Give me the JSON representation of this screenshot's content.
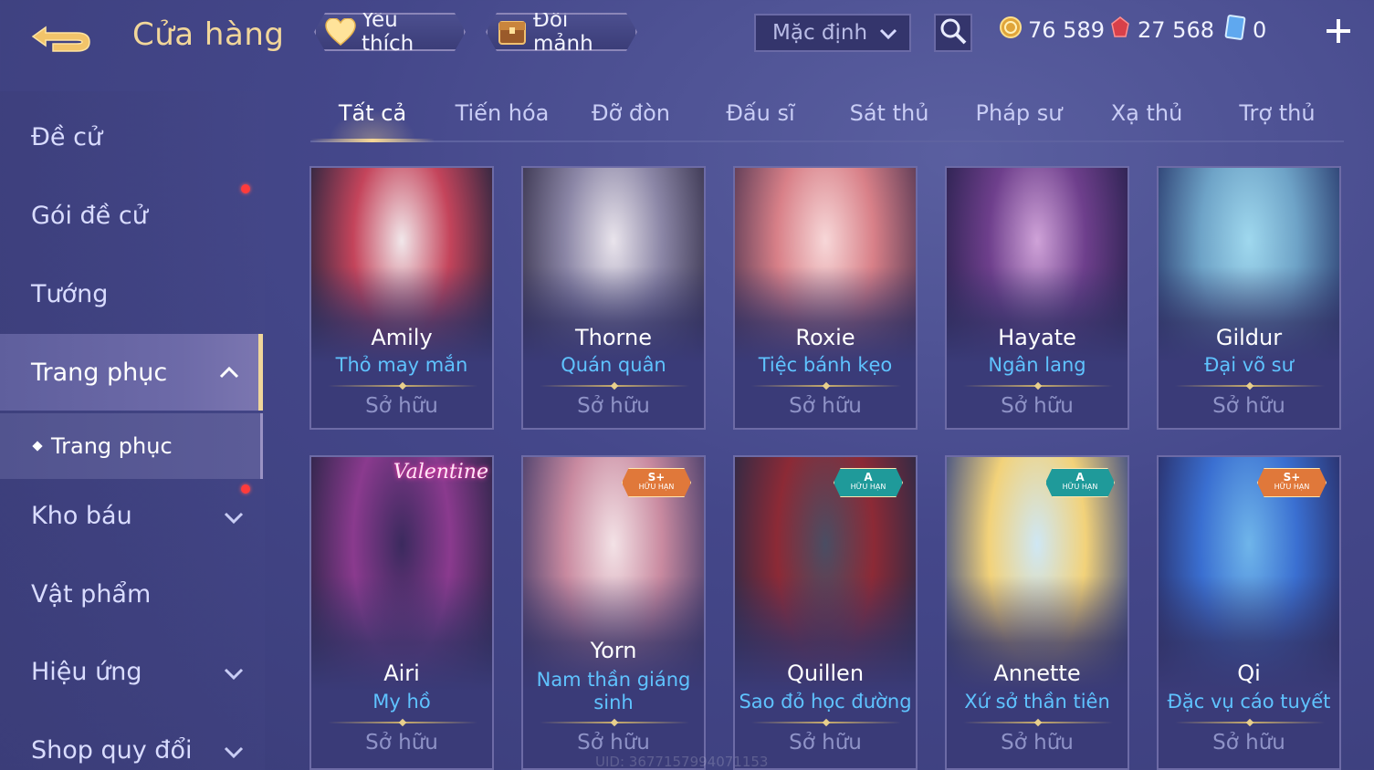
{
  "header": {
    "title": "Cửa hàng",
    "favorite_label": "Yêu thích",
    "shard_label": "Đổi mảnh",
    "sort": {
      "value": "Mặc định"
    },
    "currencies": {
      "gold": "76 589",
      "gems": "27 568",
      "cards": "0"
    }
  },
  "sidebar": {
    "items": [
      {
        "label": "Đề cử"
      },
      {
        "label": "Gói đề cử"
      },
      {
        "label": "Tướng"
      },
      {
        "label": "Trang phục"
      },
      {
        "label": "Kho báu"
      },
      {
        "label": "Vật phẩm"
      },
      {
        "label": "Hiệu ứng"
      },
      {
        "label": "Shop quy đổi"
      }
    ],
    "sub_item": {
      "label": "Trang phục"
    }
  },
  "tabs": [
    "Tất cả",
    "Tiến hóa",
    "Đỡ đòn",
    "Đấu sĩ",
    "Sát thủ",
    "Pháp sư",
    "Xạ thủ",
    "Trợ thủ"
  ],
  "cards": [
    {
      "hero": "Amily",
      "skin": "Thỏ may mắn",
      "status": "Sở hữu",
      "colors": [
        "#f1e7ea",
        "#c4445b",
        "#2a2640"
      ]
    },
    {
      "hero": "Thorne",
      "skin": "Quán quân",
      "status": "Sở hữu",
      "colors": [
        "#e9e4ec",
        "#8b86a6",
        "#3a3550"
      ]
    },
    {
      "hero": "Roxie",
      "skin": "Tiệc bánh kẹo",
      "status": "Sở hữu",
      "colors": [
        "#f7d7d8",
        "#d88088",
        "#5a3a55"
      ]
    },
    {
      "hero": "Hayate",
      "skin": "Ngân lang",
      "status": "Sở hữu",
      "colors": [
        "#cfa2d8",
        "#6e3f8c",
        "#2b2250"
      ]
    },
    {
      "hero": "Gildur",
      "skin": "Đại võ sư",
      "status": "Sở hữu",
      "colors": [
        "#9fd8ee",
        "#6ea3c7",
        "#2c3f72"
      ]
    },
    {
      "hero": "Airi",
      "skin": "My hồ",
      "status": "Sở hữu",
      "colors": [
        "#3b2a5e",
        "#8a3a8e",
        "#2c2548"
      ],
      "valentine": "Valentine"
    },
    {
      "hero": "Yorn",
      "skin": "Nam thần giáng sinh",
      "status": "Sở hữu",
      "colors": [
        "#f3e2e6",
        "#c98aa0",
        "#4a3f6c"
      ],
      "badge": {
        "rank": "S+",
        "text": "HỮU HẠN",
        "color": "#e0783a"
      }
    },
    {
      "hero": "Quillen",
      "skin": "Sao đỏ học đường",
      "status": "Sở hữu",
      "colors": [
        "#4a4d63",
        "#8c2a36",
        "#2c2a46"
      ],
      "badge": {
        "rank": "A",
        "text": "HỮU HẠN",
        "color": "#1f9a9a"
      }
    },
    {
      "hero": "Annette",
      "skin": "Xứ sở thần tiên",
      "status": "Sở hữu",
      "colors": [
        "#cfe7f4",
        "#f2d27a",
        "#3f4e84"
      ],
      "badge": {
        "rank": "A",
        "text": "HỮU HẠN",
        "color": "#1f9a9a"
      }
    },
    {
      "hero": "Qi",
      "skin": "Đặc vụ cáo tuyết",
      "status": "Sở hữu",
      "colors": [
        "#6fb5ea",
        "#3a6fd1",
        "#2a2f6a"
      ],
      "badge": {
        "rank": "S+",
        "text": "HỮU HẠN",
        "color": "#e0783a"
      }
    }
  ],
  "uid_text": "UID: 3677157994071153"
}
